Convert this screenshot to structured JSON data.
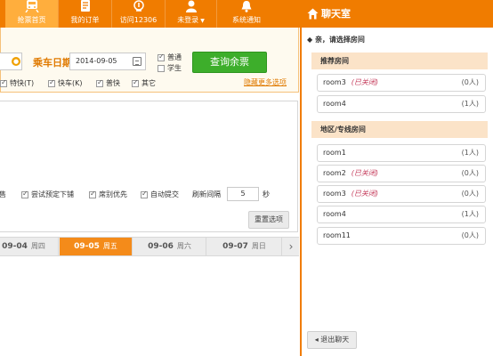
{
  "nav": {
    "items": [
      {
        "label": "抢票首页",
        "active": true
      },
      {
        "label": "我的订单"
      },
      {
        "label": "访问12306"
      },
      {
        "label": "未登录"
      },
      {
        "label": "系统通知"
      }
    ]
  },
  "search": {
    "date_label": "乘车日期",
    "date_value": "2014-09-05",
    "type_options": [
      {
        "label": "普通",
        "checked": true
      },
      {
        "label": "学生",
        "checked": false
      }
    ],
    "query_button": "查询余票",
    "train_filters": [
      {
        "label": "特快(T)",
        "checked": true
      },
      {
        "label": "快车(K)",
        "checked": true
      },
      {
        "label": "普快",
        "checked": true
      },
      {
        "label": "其它",
        "checked": true
      }
    ],
    "hide_more_link": "隐藏更多选项"
  },
  "options": {
    "partial_label": "售",
    "try_lower_berth": "尝试预定下铺",
    "seat_priority": "席别优先",
    "auto_submit": "自动提交",
    "refresh_interval_label": "刷新间隔",
    "refresh_interval_value": "5",
    "refresh_unit": "秒",
    "reset_button": "重置选项"
  },
  "date_tabs": [
    {
      "date": "09-04",
      "weekday": "周四"
    },
    {
      "date": "09-05",
      "weekday": "周五",
      "active": true
    },
    {
      "date": "09-06",
      "weekday": "周六"
    },
    {
      "date": "09-07",
      "weekday": "周日"
    }
  ],
  "chat": {
    "title": "聊天室",
    "tip": "亲，请选择房间",
    "recommended_header": "推荐房间",
    "region_header": "地区/专线房间",
    "recommended_rooms": [
      {
        "name": "room3",
        "status": "(已关闭)",
        "count": "(0人)"
      },
      {
        "name": "room4",
        "status": "",
        "count": "(1人)"
      }
    ],
    "region_rooms": [
      {
        "name": "room1",
        "status": "",
        "count": "(1人)"
      },
      {
        "name": "room2",
        "status": "(已关闭)",
        "count": "(0人)"
      },
      {
        "name": "room3",
        "status": "(已关闭)",
        "count": "(0人)"
      },
      {
        "name": "room4",
        "status": "",
        "count": "(1人)"
      },
      {
        "name": "room11",
        "status": "",
        "count": "(0人)"
      }
    ],
    "exit_button": "退出聊天"
  },
  "colors": {
    "accent": "#f07c00",
    "query_button": "#3dae2b",
    "closed": "#c43a5a"
  }
}
